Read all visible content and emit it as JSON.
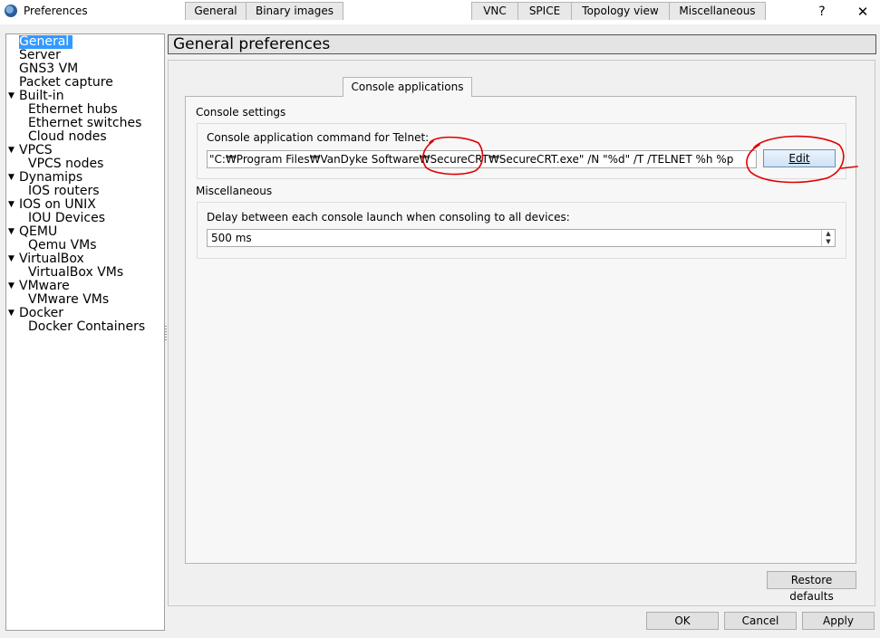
{
  "window": {
    "title": "Preferences",
    "help_label": "?",
    "close_label": "✕",
    "app_icon": "gns3-app-icon"
  },
  "sidebar": {
    "items": [
      {
        "label": "General",
        "level": 0,
        "expandable": false,
        "selected": true
      },
      {
        "label": "Server",
        "level": 0,
        "expandable": false
      },
      {
        "label": "GNS3 VM",
        "level": 0,
        "expandable": false
      },
      {
        "label": "Packet capture",
        "level": 0,
        "expandable": false
      },
      {
        "label": "Built-in",
        "level": 0,
        "expandable": true
      },
      {
        "label": "Ethernet hubs",
        "level": 1
      },
      {
        "label": "Ethernet switches",
        "level": 1
      },
      {
        "label": "Cloud nodes",
        "level": 1
      },
      {
        "label": "VPCS",
        "level": 0,
        "expandable": true
      },
      {
        "label": "VPCS nodes",
        "level": 1
      },
      {
        "label": "Dynamips",
        "level": 0,
        "expandable": true
      },
      {
        "label": "IOS routers",
        "level": 1
      },
      {
        "label": "IOS on UNIX",
        "level": 0,
        "expandable": true
      },
      {
        "label": "IOU Devices",
        "level": 1
      },
      {
        "label": "QEMU",
        "level": 0,
        "expandable": true
      },
      {
        "label": "Qemu VMs",
        "level": 1
      },
      {
        "label": "VirtualBox",
        "level": 0,
        "expandable": true
      },
      {
        "label": "VirtualBox VMs",
        "level": 1
      },
      {
        "label": "VMware",
        "level": 0,
        "expandable": true
      },
      {
        "label": "VMware VMs",
        "level": 1
      },
      {
        "label": "Docker",
        "level": 0,
        "expandable": true
      },
      {
        "label": "Docker Containers",
        "level": 1
      }
    ]
  },
  "header": {
    "title": "General preferences"
  },
  "tabs": [
    {
      "label": "General"
    },
    {
      "label": "Binary images"
    },
    {
      "label": "Console applications",
      "active": true
    },
    {
      "label": "VNC"
    },
    {
      "label": "SPICE"
    },
    {
      "label": "Topology view"
    },
    {
      "label": "Miscellaneous"
    }
  ],
  "console_settings": {
    "section_title": "Console settings",
    "telnet_label": "Console application command for Telnet:",
    "telnet_command": "\"C:₩Program Files₩VanDyke Software₩SecureCRT₩SecureCRT.exe\" /N \"%d\" /T /TELNET %h %p",
    "edit_button": "Edit"
  },
  "miscellaneous": {
    "section_title": "Miscellaneous",
    "delay_label": "Delay between each console launch when consoling to all devices:",
    "delay_value": "500 ms"
  },
  "buttons": {
    "restore_defaults": "Restore defaults",
    "ok": "OK",
    "cancel": "Cancel",
    "apply": "Apply"
  },
  "colors": {
    "selection": "#3399ff",
    "annotation": "#e00000"
  }
}
